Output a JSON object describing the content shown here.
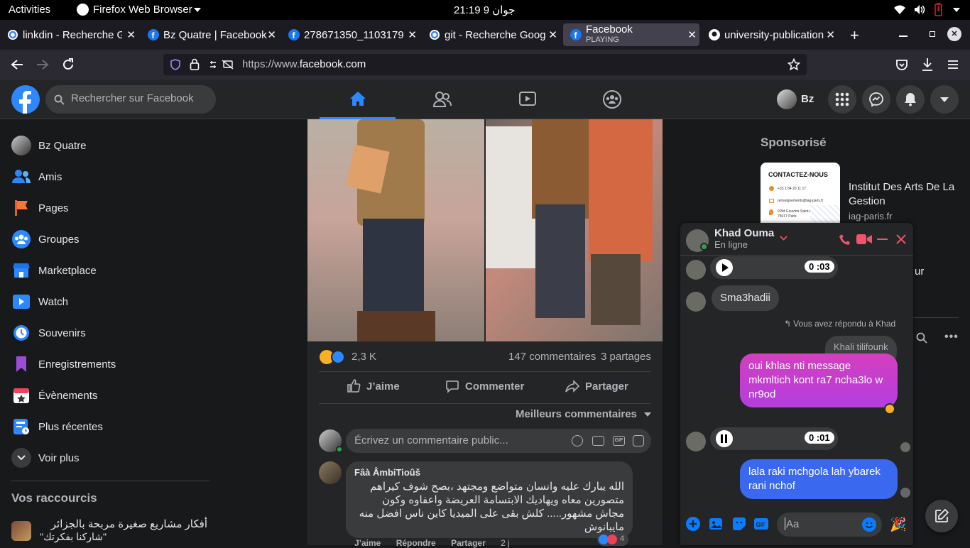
{
  "gnome": {
    "activities": "Activities",
    "app": "Firefox Web Browser",
    "clock": "21:19  9 جوان"
  },
  "tabs": [
    {
      "label": "linkdin - Recherche G"
    },
    {
      "label": "Bz Quatre | Facebook"
    },
    {
      "label": "278671350_1103179"
    },
    {
      "label": "git - Recherche Googl"
    },
    {
      "label": "Facebook",
      "sub": "PLAYING"
    },
    {
      "label": "university-publication"
    }
  ],
  "url": {
    "prefix": "https://www.",
    "domain": "facebook.com"
  },
  "fb": {
    "search_placeholder": "Rechercher sur Facebook",
    "profile_name": "Bz",
    "colors": {
      "accent": "#2d88ff",
      "bg": "#18191a",
      "card": "#242526"
    }
  },
  "sidebar": {
    "items": [
      {
        "label": "Bz Quatre",
        "icon": "avatar"
      },
      {
        "label": "Amis",
        "icon": "friends-icon"
      },
      {
        "label": "Pages",
        "icon": "pages-flag-icon"
      },
      {
        "label": "Groupes",
        "icon": "groups-icon"
      },
      {
        "label": "Marketplace",
        "icon": "marketplace-icon"
      },
      {
        "label": "Watch",
        "icon": "watch-icon"
      },
      {
        "label": "Souvenirs",
        "icon": "memories-clock-icon"
      },
      {
        "label": "Enregistrements",
        "icon": "bookmark-icon"
      },
      {
        "label": "Évènements",
        "icon": "calendar-star-icon"
      },
      {
        "label": "Plus récentes",
        "icon": "recent-feed-icon"
      },
      {
        "label": "Voir plus",
        "icon": "chevron-down-icon"
      }
    ],
    "shortcuts_title": "Vos raccourcis",
    "shortcut": {
      "line1": "أفكار مشاريع صغيرة مربحة بالجزائر",
      "line2": "\"شاركنا بفكرتك\""
    }
  },
  "post": {
    "reactions_count": "2,3 K",
    "comments_count": "147 commentaires",
    "shares_count": "3 partages",
    "like": "J’aime",
    "comment": "Commenter",
    "share": "Partager",
    "sort": "Meilleurs commentaires",
    "comment_placeholder": "Écrivez un commentaire public...",
    "comment1": {
      "author": "Fâà ÂmbiTioûš",
      "text": "الله يبارك عليه وانسان متواضع ومجتهد ،بصح شوف كيراهم متصورين معاه ويهاديك الابتسامة العريضة واعفاوه وكون مجاش مشهور..... كلش بقى على الميديا كاين ناس افضل منه مايبانوش",
      "like": "J’aime",
      "reply": "Répondre",
      "share": "Partager",
      "time": "2 j",
      "reactions": "4"
    }
  },
  "sponsor": {
    "title": "Sponsorisé",
    "ad_name": "Institut Des Arts De La Gestion",
    "ad_domain": "iag-paris.fr",
    "ad_card_title": "CONTACTEZ-NOUS",
    "ad_phone": "+33 1 84 20 11 17",
    "ad_email": "renseignements@iag-paris.fr",
    "ad_address": "9 Bd Gouvion-Saint-Cyr 75017 Paris",
    "partial_text": "ur"
  },
  "chat": {
    "name": "Khad Ouma",
    "status": "En ligne",
    "audio1_time": "0 :03",
    "msg1": "Sma3hadii",
    "reply_note": "Vous avez répondu à Khad",
    "quoted": "Khali tilifounk",
    "my_msg1": "oui khlas nti message mkmltich kont ra7 ncha3lo w nr9od",
    "audio2_time": "0 :01",
    "my_msg2": "lala raki mchgola lah ybarek rani nchof",
    "input_placeholder": "Aa"
  }
}
